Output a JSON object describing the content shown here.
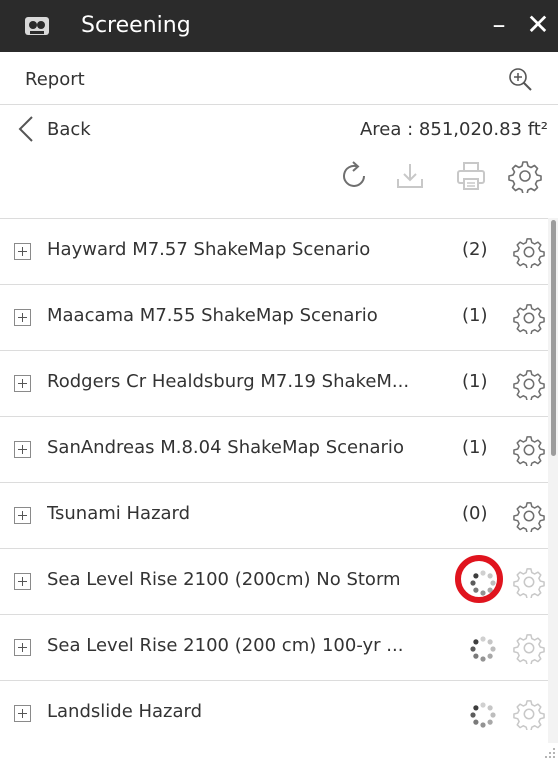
{
  "window": {
    "title": "Screening",
    "minimize_glyph": "–",
    "close_glyph": "✕"
  },
  "report": {
    "label": "Report"
  },
  "nav": {
    "back_label": "Back",
    "area_text": "Area : 851,020.83 ft²"
  },
  "toolbar": {
    "icons": [
      "refresh-icon",
      "download-icon",
      "print-icon",
      "settings-icon"
    ]
  },
  "hazards": [
    {
      "name": "Hayward M7.57 ShakeMap Scenario",
      "count": "(2)",
      "status": "done"
    },
    {
      "name": "Maacama M7.55 ShakeMap Scenario",
      "count": "(1)",
      "status": "done"
    },
    {
      "name": "Rodgers Cr Healdsburg M7.19 ShakeM...",
      "count": "(1)",
      "status": "done"
    },
    {
      "name": "SanAndreas M.8.04 ShakeMap Scenario",
      "count": "(1)",
      "status": "done"
    },
    {
      "name": "Tsunami Hazard",
      "count": "(0)",
      "status": "done"
    },
    {
      "name": "Sea Level Rise 2100 (200cm) No Storm",
      "count": "",
      "status": "loading",
      "highlighted": true
    },
    {
      "name": "Sea Level Rise 2100 (200 cm) 100-yr ...",
      "count": "",
      "status": "loading"
    },
    {
      "name": "Landslide Hazard",
      "count": "",
      "status": "loading"
    }
  ],
  "colors": {
    "titlebar": "#2b2b2b",
    "highlight": "#e0141e",
    "icon": "#6f6f6f",
    "icon_disabled": "#c8c8c8"
  }
}
